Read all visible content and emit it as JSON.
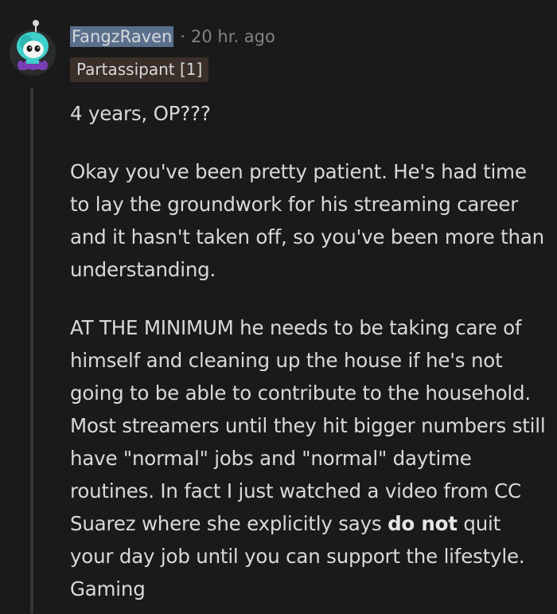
{
  "comment": {
    "username": "FangzRaven",
    "separator": "·",
    "timestamp": "20 hr. ago",
    "flair": "Partassipant [1]",
    "paragraphs": {
      "p1": "4 years, OP???",
      "p2": "Okay you've been pretty patient. He's had time to lay the groundwork for his streaming career and it hasn't taken off, so you've been more than understanding.",
      "p3_before": "AT THE MINIMUM he needs to be taking care of himself and cleaning up the house if he's not going to be able to contribute to the household. Most streamers until they hit bigger numbers still have \"normal\" jobs and \"normal\" daytime routines. In fact I just watched a video from CC Suarez where she explicitly says ",
      "p3_bold": "do not",
      "p3_after": " quit your day job until you can support the lifestyle. Gaming"
    },
    "avatar_icon": "snoo-avatar-icon",
    "colors": {
      "background": "#1a1a1b",
      "text": "#d7dadc",
      "muted": "#818384",
      "username_highlight": "#5a6f8c",
      "flair_bg": "#3b2f2a",
      "thread_line": "#343536"
    }
  }
}
